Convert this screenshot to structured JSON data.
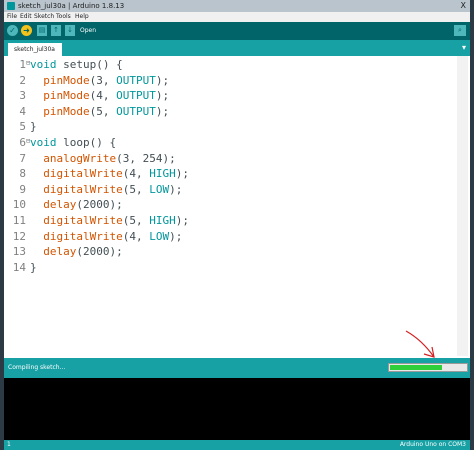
{
  "window": {
    "title": "sketch_jul30a | Arduino 1.8.13",
    "close_glyph": "X"
  },
  "menu": [
    "File",
    "Edit",
    "Sketch",
    "Tools",
    "Help"
  ],
  "toolbar": {
    "verify_icon": "check-icon",
    "upload_icon": "arrow-right-icon",
    "new_icon": "new-file-icon",
    "open_icon": "open-arrow-up-icon",
    "save_icon": "save-arrow-down-icon",
    "label": "Open",
    "serial_icon": "magnifier-icon"
  },
  "tab": {
    "name": "sketch_jul30a",
    "menu_glyph": "▾"
  },
  "editor": {
    "lines": [
      {
        "n": "1",
        "fold": "⊟",
        "tokens": [
          [
            "t",
            "void"
          ],
          [
            "p",
            " setup() {"
          ]
        ]
      },
      {
        "n": "2",
        "fold": "",
        "tokens": [
          [
            "p",
            "  "
          ],
          [
            "b",
            "pinMode"
          ],
          [
            "p",
            "(3, "
          ],
          [
            "c",
            "OUTPUT"
          ],
          [
            "p",
            ");"
          ]
        ]
      },
      {
        "n": "3",
        "fold": "",
        "tokens": [
          [
            "p",
            "  "
          ],
          [
            "b",
            "pinMode"
          ],
          [
            "p",
            "(4, "
          ],
          [
            "c",
            "OUTPUT"
          ],
          [
            "p",
            ");"
          ]
        ]
      },
      {
        "n": "4",
        "fold": "",
        "tokens": [
          [
            "p",
            "  "
          ],
          [
            "b",
            "pinMode"
          ],
          [
            "p",
            "(5, "
          ],
          [
            "c",
            "OUTPUT"
          ],
          [
            "p",
            ");"
          ]
        ]
      },
      {
        "n": "5",
        "fold": "",
        "tokens": [
          [
            "p",
            "}"
          ]
        ]
      },
      {
        "n": "6",
        "fold": "⊟",
        "tokens": [
          [
            "t",
            "void"
          ],
          [
            "p",
            " loop() {"
          ]
        ]
      },
      {
        "n": "7",
        "fold": "",
        "tokens": [
          [
            "p",
            "  "
          ],
          [
            "b",
            "analogWrite"
          ],
          [
            "p",
            "(3, 254);"
          ]
        ]
      },
      {
        "n": "8",
        "fold": "",
        "tokens": [
          [
            "p",
            "  "
          ],
          [
            "b",
            "digitalWrite"
          ],
          [
            "p",
            "(4, "
          ],
          [
            "c",
            "HIGH"
          ],
          [
            "p",
            ");"
          ]
        ]
      },
      {
        "n": "9",
        "fold": "",
        "tokens": [
          [
            "p",
            "  "
          ],
          [
            "b",
            "digitalWrite"
          ],
          [
            "p",
            "(5, "
          ],
          [
            "c",
            "LOW"
          ],
          [
            "p",
            ");"
          ]
        ]
      },
      {
        "n": "10",
        "fold": "",
        "tokens": [
          [
            "p",
            "  "
          ],
          [
            "b",
            "delay"
          ],
          [
            "p",
            "(2000);"
          ]
        ]
      },
      {
        "n": "11",
        "fold": "",
        "tokens": [
          [
            "p",
            "  "
          ],
          [
            "b",
            "digitalWrite"
          ],
          [
            "p",
            "(5, "
          ],
          [
            "c",
            "HIGH"
          ],
          [
            "p",
            ");"
          ]
        ]
      },
      {
        "n": "12",
        "fold": "",
        "tokens": [
          [
            "p",
            "  "
          ],
          [
            "b",
            "digitalWrite"
          ],
          [
            "p",
            "(4, "
          ],
          [
            "c",
            "LOW"
          ],
          [
            "p",
            ");"
          ]
        ]
      },
      {
        "n": "13",
        "fold": "",
        "tokens": [
          [
            "p",
            "  "
          ],
          [
            "b",
            "delay"
          ],
          [
            "p",
            "(2000);"
          ]
        ]
      },
      {
        "n": "14",
        "fold": "",
        "tokens": [
          [
            "p",
            "}"
          ]
        ]
      }
    ]
  },
  "status": {
    "text": "Compiling sketch...",
    "progress_fraction": 0.68
  },
  "console": {
    "text": ""
  },
  "footer": {
    "line": "1",
    "board": "Arduino Uno on COM3"
  },
  "colors": {
    "toolbar": "#006468",
    "teal": "#17a1a5",
    "keyword_type": "#00979c",
    "keyword_builtin": "#d35400",
    "progress": "#2fcf3a",
    "annotation_arrow": "#d42020"
  }
}
